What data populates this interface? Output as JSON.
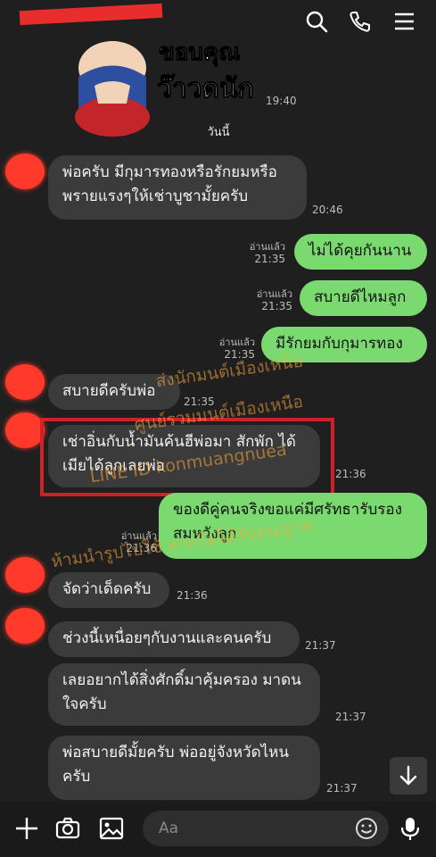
{
  "sticker": {
    "text_line1": "ขอบคุณ",
    "text_line2": "ว๊าวดนัก",
    "time": "19:40"
  },
  "date_label": "วันนี้",
  "messages": [
    {
      "side": "in",
      "text_line1": "พ่อครับ มีกุมารทองหรือรักยมหรือ",
      "text_line2": "พรายแรงๆให้เช่าบูชามั้ยครับ",
      "time": "20:46"
    },
    {
      "side": "out",
      "read": "อ่านแล้ว",
      "time": "21:35",
      "text": "ไม่ได้คุยกันนาน"
    },
    {
      "side": "out",
      "read": "อ่านแล้ว",
      "time": "21:35",
      "text": "สบายดีไหมลูก"
    },
    {
      "side": "out",
      "read": "อ่านแล้ว",
      "time": "21:35",
      "text": "มีรักยมกับกุมารทอง"
    },
    {
      "side": "in",
      "text": "สบายดีครับพ่อ",
      "time": "21:35"
    },
    {
      "side": "in",
      "text_line1": "เช่าอิ่นกับน้ำมันค้นฮีพ่อมา สักพัก ได้",
      "text_line2": "เมียได้ลูกเลยพ่อ",
      "time": "21:36"
    },
    {
      "side": "out",
      "read": "อ่านแล้ว",
      "time": "21:36",
      "text_line1": "ของดีคู่คนจริงขอแค่มีศรัทธารับรอง",
      "text_line2": "สมหวังลูก"
    },
    {
      "side": "in",
      "text": "จัดว่าเด็ดครับ",
      "time": "21:36"
    },
    {
      "side": "in",
      "text": "ช่วงนี้เหนื่อยๆกับงานและคนครับ",
      "time": "21:37"
    },
    {
      "side": "in",
      "text_line1": "เลยอยากได้สิ่งศักดิ์มาคุ้มครอง มาดน",
      "text_line2": "ใจครับ",
      "time": "21:37"
    },
    {
      "side": "in",
      "text_line1": "พ่อสบายดีมั้ยครับ พ่ออยู่จังหวัดไหน",
      "text_line2": "ครับ",
      "time": "21:37"
    }
  ],
  "watermarks": [
    "ส่งนักมนต์เมืองเหนือ",
    "ศูนย์รวมมนต์เมืองเหนือ",
    "LINE ID konmuangnuea",
    "ห้ามนำรูปไปใช้ หากไม่ได้รับอนุญาต"
  ],
  "composer": {
    "placeholder": "Aa"
  },
  "icons": {
    "top": [
      "search-icon",
      "phone-icon",
      "menu-icon"
    ],
    "bottom": [
      "plus-icon",
      "camera-icon",
      "image-icon",
      "emoji-icon",
      "mic-icon"
    ],
    "scroll": "chevron-down-icon"
  },
  "colors": {
    "incoming_bubble": "#3b3b3b",
    "outgoing_bubble": "#7ad96f",
    "highlight_box": "#d0202a",
    "background": "#1f1f1f"
  }
}
